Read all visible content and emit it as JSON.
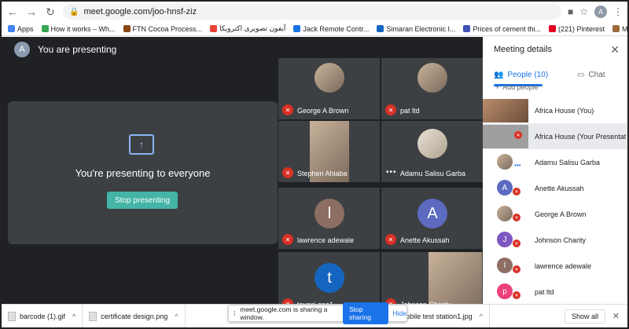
{
  "browser": {
    "url": "meet.google.com/joo-hnsf-ziz",
    "profile_initial": "A",
    "bookmarks": [
      {
        "label": "Apps",
        "color": "#4285f4"
      },
      {
        "label": "How it works – Wh...",
        "color": "#34a853"
      },
      {
        "label": "FTN Cocoa Process...",
        "color": "#8b4513"
      },
      {
        "label": "آیفون تصویری اکترویکا",
        "color": "#ea4335"
      },
      {
        "label": "Jack Remote Contr...",
        "color": "#1a73e8"
      },
      {
        "label": "Simaran Electronic I...",
        "color": "#1565c0"
      },
      {
        "label": "Prices of cement thi...",
        "color": "#3f51b5"
      },
      {
        "label": "(221) Pinterest",
        "color": "#e60023"
      },
      {
        "label": "MILITARY PRODUC...",
        "color": "#9c6b3a"
      }
    ]
  },
  "meet": {
    "presenter_initial": "A",
    "header": "You are presenting",
    "present_title": "You're presenting to everyone",
    "stop_label": "Stop presenting",
    "tiles": [
      {
        "name": "George A Brown",
        "kind": "photo"
      },
      {
        "name": "pat ltd",
        "kind": "photo"
      },
      {
        "name": "Stephen Ahiaba",
        "kind": "photo"
      },
      {
        "name": "Adamu Salisu Garba",
        "kind": "photo",
        "speaking": true
      },
      {
        "name": "lawrence adewale",
        "kind": "initial",
        "initial": "l",
        "color": "#8d6e63"
      },
      {
        "name": "Anette Akussah",
        "kind": "initial",
        "initial": "A",
        "color": "#5c6bc0"
      },
      {
        "name": "toyosi ene1",
        "kind": "initial",
        "initial": "t",
        "color": "#1565c0"
      },
      {
        "name": "Johnson Charity",
        "kind": "photo"
      }
    ]
  },
  "panel": {
    "title": "Meeting details",
    "tab_people": "People (10)",
    "tab_chat": "Chat",
    "add_people": "Add people",
    "participants": [
      {
        "name": "Africa House (You)",
        "kind": "thumb"
      },
      {
        "name": "Africa House (Your Presentatio...",
        "kind": "thumb-present"
      },
      {
        "name": "Adamu Salisu Garba",
        "kind": "photo-small"
      },
      {
        "name": "Anette Akussah",
        "kind": "initial",
        "initial": "A",
        "color": "#5c6bc0"
      },
      {
        "name": "George A Brown",
        "kind": "photo-small"
      },
      {
        "name": "Johnson Charity",
        "kind": "initial",
        "initial": "J",
        "color": "#7e57c2"
      },
      {
        "name": "lawrence adewale",
        "kind": "initial",
        "initial": "l",
        "color": "#8d6e63"
      },
      {
        "name": "pat ltd",
        "kind": "initial",
        "initial": "p",
        "color": "#ec407a"
      }
    ]
  },
  "downloads": {
    "items": [
      "barcode (1).gif",
      "certificate design.png",
      "mobile test station1.jpg"
    ],
    "show_all": "Show all"
  },
  "share_banner": {
    "text": "meet.google.com is sharing a window.",
    "stop_label": "Stop sharing",
    "hide_label": "Hide"
  }
}
